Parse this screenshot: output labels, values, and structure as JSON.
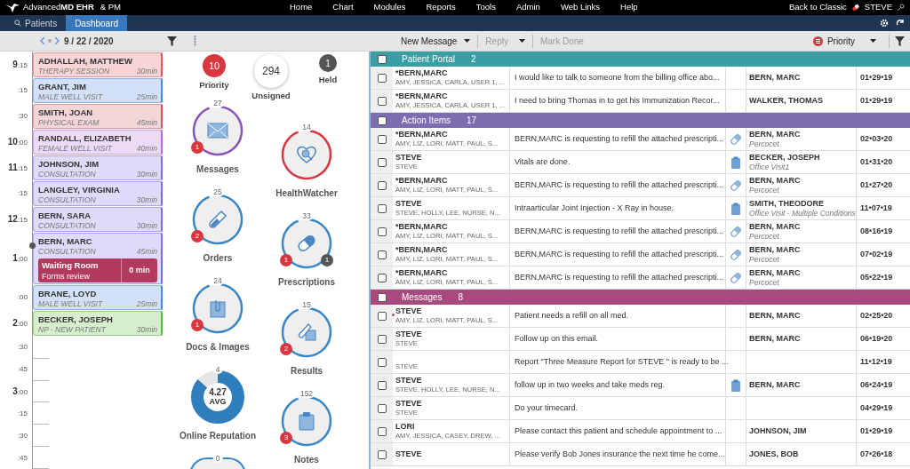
{
  "top_bar": {
    "logo": "Advanced**MD EHR**",
    "logo_suffix": "& PM",
    "menu": [
      "Home",
      "Chart",
      "Modules",
      "Reports",
      "Tools",
      "Admin",
      "Web Links",
      "Help"
    ],
    "back_link": "Back to Classic",
    "user": "STEVE"
  },
  "nav_tabs": [
    {
      "label": "Patients",
      "selected": false
    },
    {
      "label": "Dashboard",
      "selected": true
    }
  ],
  "schedule": {
    "date": "9 / 22 / 2020",
    "appointments": [
      {
        "hour": "9",
        "minutes": ":15",
        "patient": "ADHALLAH, MATTHEW",
        "type": "THERAPY SESSION",
        "duration": "30min",
        "color": "#e0565b"
      },
      {
        "minutes": ":15",
        "patient": "GRANT, JIM",
        "type": "MALE WELL VISIT",
        "duration": "25min",
        "color": "#4a86e0"
      },
      {
        "minutes": ":30",
        "patient": "SMITH, JOAN",
        "type": "PHYSICAL EXAM",
        "duration": "45min",
        "color": "#c9575f"
      },
      {
        "hour": "10",
        "minutes": ":00",
        "patient": "RANDALL, ELIZABETH",
        "type": "FEMALE WELL VISIT",
        "duration": "40min",
        "color": "#b56ae0"
      },
      {
        "hour": "11",
        "minutes": ":15",
        "patient": "JOHNSON, JIM",
        "type": "CONSULTATION",
        "duration": "30min",
        "color": "#7a6de0"
      },
      {
        "minutes": ":15",
        "patient": "LANGLEY, VIRGINIA",
        "type": "CONSULTATION",
        "duration": "30min",
        "color": "#7a6de0"
      },
      {
        "hour": "12",
        "minutes": ":15",
        "patient": "BERN, SARA",
        "type": "CONSULTATION",
        "duration": "30min",
        "color": "#7a6de0"
      },
      {
        "hour": "1",
        "minutes": ":00",
        "patient": "BERN, MARC",
        "type": "CONSULTATION",
        "duration": "45min",
        "color": "#7a6de0",
        "waiting": {
          "title": "Waiting Room",
          "note": "Forms review",
          "time": "0 min"
        }
      },
      {
        "minutes": ":00",
        "patient": "BRANE, LOYD",
        "type": "MALE WELL VISIT",
        "duration": "25min",
        "color": "#4a86e0"
      },
      {
        "hour": "2",
        "minutes": ":00",
        "patient": "BECKER, JOSEPH",
        "type": "NP - NEW PATIENT",
        "duration": "30min",
        "color": "#5cb83c"
      }
    ],
    "open_slots": [
      {
        "minutes": ":30"
      },
      {
        "minutes": ":45"
      },
      {
        "hour": "3",
        "minutes": ":00"
      },
      {
        "minutes": ":15"
      },
      {
        "minutes": ":30"
      },
      {
        "minutes": ":45"
      }
    ]
  },
  "counters": [
    {
      "kind": "priority",
      "count": "10",
      "label": "Priority"
    },
    {
      "kind": "unsigned",
      "count": "294",
      "label": "Unsigned"
    },
    {
      "kind": "held",
      "count": "1",
      "label": "Held"
    }
  ],
  "widgets": [
    {
      "kind": "messages",
      "count": "27",
      "label": "Messages",
      "color": "#8a55b8",
      "badges": [
        {
          "count": "1",
          "color": "#d9373f"
        }
      ]
    },
    {
      "kind": "healthwatcher",
      "count": "14",
      "label": "HealthWatcher",
      "color": "#d9373f"
    },
    {
      "kind": "orders",
      "count": "25",
      "label": "Orders",
      "color": "#3a87c4",
      "badges": [
        {
          "count": "2",
          "color": "#d9373f"
        }
      ]
    },
    {
      "kind": "prescriptions",
      "count": "33",
      "label": "Prescriptions",
      "color": "#3a87c4",
      "badges": [
        {
          "count": "1",
          "color": "#d9373f"
        },
        {
          "count": "1",
          "color": "#555555"
        }
      ]
    },
    {
      "kind": "docs",
      "count": "24",
      "label": "Docs & Images",
      "color": "#3a87c4",
      "badges": [
        {
          "count": "1",
          "color": "#d9373f"
        }
      ]
    },
    {
      "kind": "results",
      "count": "15",
      "label": "Results",
      "color": "#3a87c4",
      "badges": [
        {
          "count": "2",
          "color": "#d9373f"
        }
      ]
    },
    {
      "kind": "reputation",
      "count": "4",
      "label": "Online Reputation",
      "color": "#2f7fbf",
      "rating": "4.27",
      "rating_label": "AVG",
      "level": 0.86
    },
    {
      "kind": "notes",
      "count": "152",
      "label": "Notes",
      "color": "#3a87c4",
      "badges": [
        {
          "count": "3",
          "color": "#d9373f"
        }
      ]
    }
  ],
  "partial_widget": {
    "count": "0"
  },
  "toolbar": {
    "new_message": "New Message",
    "reply": {
      "label": "Reply",
      "disabled": true
    },
    "mark_done": {
      "label": "Mark Done",
      "disabled": true
    },
    "sort": "Priority"
  },
  "inbox": [
    {
      "title": "Patient Portal",
      "count": "2",
      "color": "#3a9fa3",
      "checked": false,
      "rows": [
        {
          "checked": false,
          "unread": false,
          "from": "*BERN,MARC",
          "to": "AMY, JESSICA, CARLA, USER 1, ...",
          "message": "I would like to talk to someone from the billing office abo...",
          "patient": "BERN, MARC",
          "date": "01•29•19"
        },
        {
          "checked": false,
          "unread": false,
          "from": "*BERN,MARC",
          "to": "AMY, JESSICA, CARLA, USER 1, ...",
          "message": "I need to bring Thomas in to get his Immunization Recor...",
          "patient": "WALKER, THOMAS",
          "date": "01•29•19"
        }
      ]
    },
    {
      "title": "Action Items",
      "count": "17",
      "color": "#7b6db0",
      "checked": false,
      "rows": [
        {
          "checked": false,
          "unread": false,
          "from": "*BERN,MARC",
          "to": "AMY, LIZ, LORI, MATT, PAUL, S...",
          "message": "BERN,MARC is requesting to refill the attached prescripti...",
          "kind": "prescription",
          "patient": "BERN, MARC",
          "detail": "Percocet",
          "date": "02•03•20"
        },
        {
          "checked": false,
          "unread": false,
          "from": "STEVE",
          "to": "STEVE",
          "message": "Vitals are done.",
          "kind": "visit",
          "patient": "BECKER, JOSEPH",
          "detail": "Office Visit1",
          "date": "01•31•20"
        },
        {
          "checked": false,
          "unread": false,
          "from": "*BERN,MARC",
          "to": "AMY, LIZ, LORI, MATT, PAUL, S...",
          "message": "BERN,MARC is requesting to refill the attached prescripti...",
          "kind": "prescription",
          "patient": "BERN, MARC",
          "detail": "Percocet",
          "date": "01•27•20"
        },
        {
          "checked": false,
          "unread": false,
          "from": "STEVE",
          "to": "STEVE, HOLLY, LEE, NURSE, N...",
          "message": "Intraarticular Joint Injection - X Ray in house.",
          "kind": "visit",
          "patient": "SMITH, THEODORE",
          "detail": "Office Visit - Multiple Conditions",
          "date": "11•07•19"
        },
        {
          "checked": false,
          "unread": false,
          "from": "*BERN,MARC",
          "to": "AMY, LIZ, LORI, MATT, PAUL, S...",
          "message": "BERN,MARC is requesting to refill the attached prescripti...",
          "kind": "prescription",
          "patient": "BERN, MARC",
          "detail": "Percocet",
          "date": "08•16•19"
        },
        {
          "checked": false,
          "unread": false,
          "from": "*BERN,MARC",
          "to": "AMY, LIZ, LORI, MATT, PAUL, S...",
          "message": "BERN,MARC is requesting to refill the attached prescripti...",
          "kind": "prescription",
          "patient": "BERN, MARC",
          "detail": "Percocet",
          "date": "07•02•19"
        },
        {
          "checked": false,
          "unread": false,
          "from": "*BERN,MARC",
          "to": "AMY, LIZ, LORI, MATT, PAUL, S...",
          "message": "BERN,MARC is requesting to refill the attached prescripti...",
          "kind": "prescription",
          "patient": "BERN, MARC",
          "detail": "Percocet",
          "date": "05•22•19"
        }
      ]
    },
    {
      "title": "Messages",
      "count": "8",
      "color": "#a84a7e",
      "checked": false,
      "rows": [
        {
          "checked": false,
          "unread": true,
          "from": "STEVE",
          "to": "AMY, LIZ, LORI, MATT, PAUL, S...",
          "message": "Patient needs a refill on all med.",
          "patient": "BERN, MARC",
          "date": "02•25•20"
        },
        {
          "checked": false,
          "unread": false,
          "from": "STEVE",
          "to": "STEVE",
          "message": "Follow up on this email.",
          "patient": "BERN, MARC",
          "date": "06•19•20"
        },
        {
          "checked": false,
          "unread": false,
          "to": "STEVE",
          "message": "Report \"Three Measure Report for STEVE \" is ready to be ...",
          "date": "11•12•19"
        },
        {
          "checked": false,
          "unread": false,
          "from": "STEVE",
          "to": "STEVE, HOLLY, LEE, NURSE, N...",
          "message": "follow up in two weeks and take meds reg.",
          "kind": "visit",
          "patient": "BERN, MARC",
          "date": "06•24•19"
        },
        {
          "checked": false,
          "unread": false,
          "from": "STEVE",
          "to": "STEVE",
          "message": "Do your timecard.",
          "date": "04•29•19"
        },
        {
          "checked": false,
          "unread": false,
          "from": "LORI",
          "to": "AMY, JESSICA, CASEY, DREW, ...",
          "message": "Please contact this patient and schedule appointment to ...",
          "patient": "JOHNSON, JIM",
          "date": "01•29•19"
        },
        {
          "checked": false,
          "unread": false,
          "from": "STEVE",
          "message": "Please verify Bob Jones insurance the next time he come...",
          "patient": "JONES, BOB",
          "date": "07•26•18"
        }
      ]
    }
  ]
}
